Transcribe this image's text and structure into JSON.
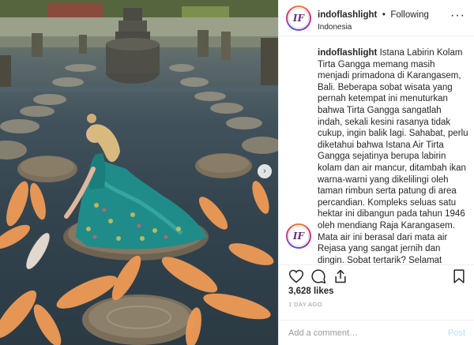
{
  "post": {
    "username": "indoflashlight",
    "separator": "•",
    "follow_status": "Following",
    "location": "Indonesia",
    "avatar_initials": "IF",
    "photo_alt": "Woman in floral dress kneeling on stepping stone among koi fish at Tirta Gangga",
    "caption_username": "indoflashlight",
    "caption_body": " Istana Labirin Kolam Tirta Gangga memang masih menjadi primadona di Karangasem, Bali. Beberapa sobat wisata yang pernah ketempat ini menuturkan bahwa Tirta Gangga sangatlah indah, sekali kesini rasanya tidak cukup, ingin balik lagi. Sahabat, perlu diketahui bahwa Istana Air Tirta Gangga sejatinya berupa labirin kolam dan air mancur, ditambah ikan warna-warni yang dikelilingi oleh taman rimbun serta patung di area percandian. Kompleks seluas satu hektar ini dibangun pada tahun 1946 oleh mendiang Raja Karangasem. Mata air ini berasal dari mata air Rejasa yang sangat jernih dan dingin. Sobat tertarik? Selamat",
    "likes": "3,628 likes",
    "time_ago": "1 DAY AGO",
    "comment_placeholder": "Add a comment…",
    "post_label": "Post"
  },
  "icons": {
    "more": "more-options-icon",
    "like": "heart-icon",
    "comment": "comment-icon",
    "share": "share-icon",
    "save": "bookmark-icon",
    "next": "chevron-right-icon"
  },
  "colors": {
    "text": "#262626",
    "muted": "#999999",
    "border": "#efefef",
    "post_disabled": "#b2dffc",
    "koi_orange": "#f0a060",
    "dress_teal": "#1f8c8a"
  }
}
